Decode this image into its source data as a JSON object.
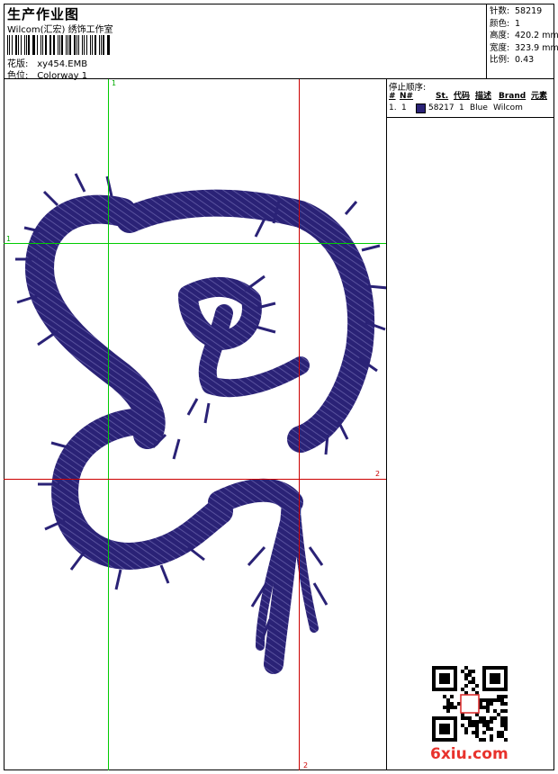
{
  "header": {
    "title": "生产作业图",
    "subtitle": "Wilcom(汇宏) 绣饰工作室",
    "design_label": "花版:",
    "design_value": "xy454.EMB",
    "colorway_label": "色位:",
    "colorway_value": "Colorway 1"
  },
  "stats": [
    {
      "label": "针数:",
      "value": "58219"
    },
    {
      "label": "颜色:",
      "value": "1"
    },
    {
      "label": "高度:",
      "value": "420.2 mm"
    },
    {
      "label": "宽度:",
      "value": "323.9 mm"
    },
    {
      "label": "比例:",
      "value": "0.43"
    }
  ],
  "stop_sequence": {
    "title": "停止顺序:",
    "headers": [
      "#",
      "N#",
      "St.",
      "代码",
      "描述",
      "Brand",
      "元素"
    ],
    "rows": [
      {
        "num": "1.",
        "n": "1",
        "stitches": "58217",
        "code": "1",
        "desc": "Blue",
        "brand": "Wilcom",
        "swatch": "#2a2276"
      }
    ]
  },
  "guides": {
    "green_label_top": "1",
    "green_label_left": "1",
    "red_label_right": "2",
    "red_label_bottom": "2"
  },
  "colors": {
    "thread": "#2a2276",
    "guide_green": "#00cc00",
    "guide_red": "#cc0000"
  },
  "watermark": "6xiu.com"
}
